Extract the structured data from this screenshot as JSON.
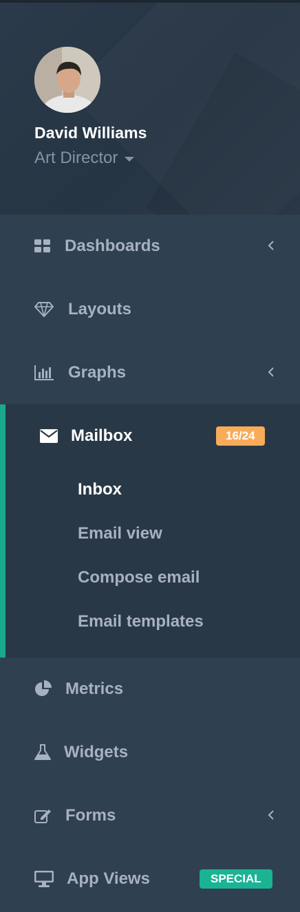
{
  "profile": {
    "name": "David Williams",
    "role": "Art Director"
  },
  "nav": {
    "dashboards": {
      "label": "Dashboards",
      "icon": "th-large-icon"
    },
    "layouts": {
      "label": "Layouts",
      "icon": "diamond-icon"
    },
    "graphs": {
      "label": "Graphs",
      "icon": "bar-chart-icon"
    },
    "mailbox": {
      "label": "Mailbox",
      "icon": "envelope-icon",
      "badge": "16/24",
      "badge_color": "#f8ac59",
      "sub_items": [
        "Inbox",
        "Email view",
        "Compose email",
        "Email templates"
      ],
      "current_sub": "Inbox"
    },
    "metrics": {
      "label": "Metrics",
      "icon": "pie-chart-icon"
    },
    "widgets": {
      "label": "Widgets",
      "icon": "flask-icon"
    },
    "forms": {
      "label": "Forms",
      "icon": "edit-icon"
    },
    "app_views": {
      "label": "App Views",
      "icon": "desktop-icon",
      "badge": "SPECIAL",
      "badge_color": "#1ab394"
    }
  },
  "colors": {
    "sidebar_bg": "#2f4050",
    "active_bg": "#293846",
    "accent": "#19aa8d",
    "text": "#a7b1c2"
  }
}
